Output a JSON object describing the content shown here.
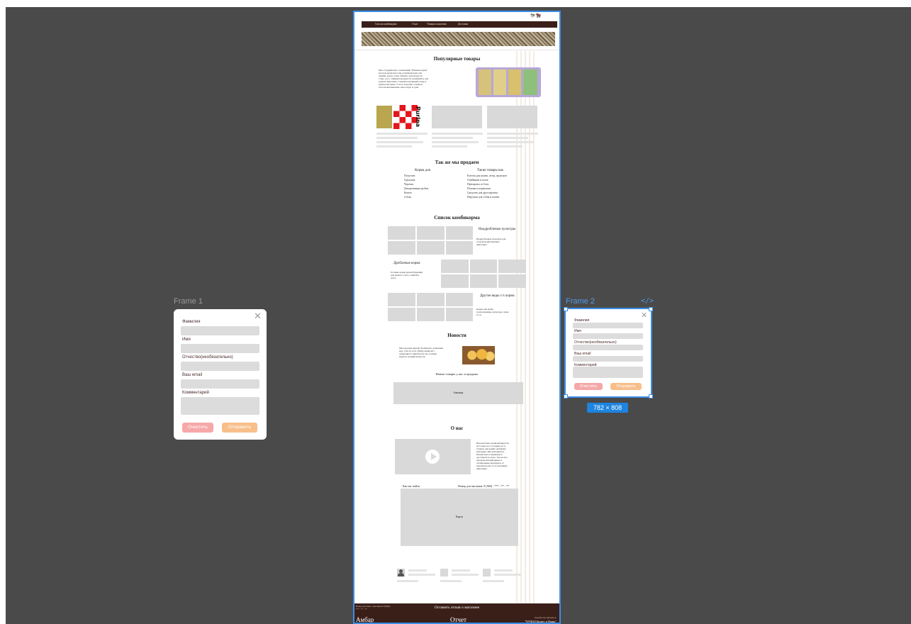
{
  "colors": {
    "canvas": "#4a4a4a",
    "selection": "#3b8ee6",
    "nav": "#3a1f19",
    "clear_btn": "#f6a8a8",
    "send_btn": "#f8bf8b"
  },
  "frame1": {
    "label": "Frame 1",
    "close_icon": "close-icon",
    "fields": [
      "Фамилия",
      "Имя",
      "Отчество(необязательно)",
      "Ваш email",
      "Комментарий"
    ],
    "clear_label": "Очистить",
    "send_label": "Отправить"
  },
  "frame2": {
    "label": "Frame 2",
    "code_icon": "</>",
    "size_badge": "782 × 808",
    "fields": [
      "Фамилия",
      "Имя",
      "Отчество(необязательно)",
      "Ваш email",
      "Комментарий"
    ],
    "clear_label": "Очистить",
    "send_label": "Отправить"
  },
  "site": {
    "logo": "Амбар",
    "nav": [
      "Список комбикорма",
      "О нас",
      "Товары в наличии",
      "Доставка"
    ],
    "popular": {
      "title": "Популярные товары",
      "text": "Мы сотрудничаем с компанией \"Южные корма\" которая выпускает как отличный корм для свиней, коров, птиц. Обычно используется старт, рост, а финиш продаются в комбинате для разных животных. Самый популярный товар в нашем магазине. У него хорошие отзывы и богатая витаминами смесь круп и трав.",
      "brand": "Purina"
    },
    "also": {
      "title": "Так же мы продаем",
      "col1_title": "Корма для",
      "col1": [
        "Попугаев",
        "Грызунов",
        "Черепах",
        "Декоративных рыбок",
        "Кошек",
        "Собак"
      ],
      "col2_title": "Такие товары как",
      "col2": [
        "Клетки для кошек, птиц, грызунов",
        "Ошейники и шлея",
        "Препараты от блох",
        "Поилки и кормушки",
        "Средства для дрессировки",
        "Игрушки для собак и кошек"
      ]
    },
    "feed": {
      "title": "Список комбикорма",
      "item1_title": "Неддробленые культуры",
      "item1_text": "Неддробленые культуры для сельскохозяйственных животных",
      "item2_title": "Дробленые корма",
      "item2_text": "Готовые корма разной фракции для мелкого скота, свиней и скота",
      "item3_title": "Другие виды с/х корма",
      "item3_text": "Корма для рыбы, гранулованные культуры, трава и т.д."
    },
    "news": {
      "title": "Новости",
      "text": "Мы продаем цыплят бройлеров, домашних кур, утят и гусят. Птицу привозят с доверенного инкубатора где за ними ведется лучший контроль",
      "new_goods": "Новые товары у нас в продаже",
      "banner": "баннер"
    },
    "about": {
      "title": "О нас",
      "text": "Наш магазин специализируется не только на с/х кормах но и товарах для ваших любимых питомцев. Мы находимся в Ильинском и занимаемся доставкой до дома. Так же мы продаем ветеринарные и специальные препараты от паразитов для с/х и домашних животных.",
      "how_to_find": "Как нас найти",
      "phone": "Номер для магазина: 8 (960) - *** - ** - **",
      "map": "Карта"
    },
    "footer": {
      "feedback": "Оставить отзыв о магазине",
      "left_text": "Номер для связи с магазином: 8 (960) - *** - ** - **",
      "logo": "Амбар",
      "report": "Отчет",
      "dev_label": "Разработано Дунаева А.",
      "dev_org": "\"ЧУПОО Бизнес и Право\""
    }
  }
}
